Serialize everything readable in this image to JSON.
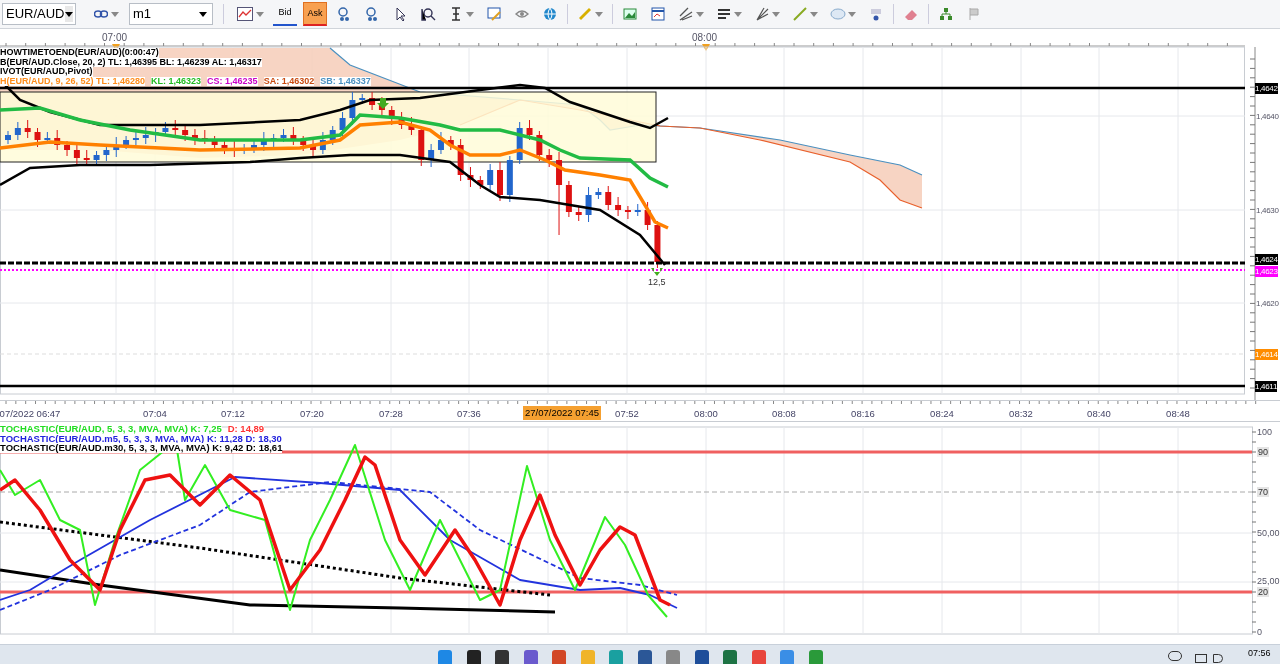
{
  "toolbar": {
    "symbol": "EUR/AUD",
    "timeframe": "m1",
    "price_buttons": [
      {
        "label": "Bid",
        "selected": false
      },
      {
        "label": "Ask",
        "selected": true
      }
    ]
  },
  "top_time_axis": {
    "labels": [
      "07:00",
      "08:00"
    ]
  },
  "main_chart": {
    "legend": [
      [
        {
          "text": "HOWTIMETOEND(EUR/AUD)(0:00:47)",
          "color": "#000000"
        }
      ],
      [
        {
          "text": "B(EUR/AUD.Close, 20, 2)  TL: 1,46395  BL: 1,46239  AL: 1,46317",
          "color": "#000000"
        }
      ],
      [
        {
          "text": "IVOT(EUR/AUD,Pivot)",
          "color": "#000000"
        }
      ],
      [
        {
          "text": "H(EUR/AUD, 9, 26, 52)  TL: 1,46280",
          "color": "#ff8c1a"
        },
        {
          "text": "KL: 1,46323",
          "color": "#22bb22"
        },
        {
          "text": "CS: 1,46235",
          "color": "#c800c8"
        },
        {
          "text": "SA: 1,46302",
          "color": "#c84a10"
        },
        {
          "text": "SB: 1,46337",
          "color": "#4a90c0"
        }
      ]
    ],
    "price_labels": [
      {
        "text": "1,4642",
        "kind": "badge",
        "color": "#000000"
      },
      {
        "text": "1,4640",
        "kind": "tick"
      },
      {
        "text": "1,4630",
        "kind": "tick"
      },
      {
        "text": "1,4624",
        "kind": "badge",
        "color": "#000000"
      },
      {
        "text": "1,4623",
        "kind": "badge",
        "color": "#ff00ff"
      },
      {
        "text": "1,4620",
        "kind": "tick"
      },
      {
        "text": "1,4614",
        "kind": "badge",
        "color": "#ff8c00"
      },
      {
        "text": "1,4611",
        "kind": "badge",
        "color": "#000000"
      }
    ],
    "marker_label": "12,5"
  },
  "time_axis": {
    "labels": [
      "07/2022 06:47",
      "07:04",
      "07:12",
      "07:20",
      "07:28",
      "07:36",
      "07:52",
      "08:00",
      "08:08",
      "08:16",
      "08:24",
      "08:32",
      "08:40",
      "08:48"
    ],
    "cursor_label": "27/07/2022 07:45"
  },
  "stochastic": {
    "legend": [
      [
        {
          "text": "TOCHASTIC(EUR/AUD, 5, 3, 3, MVA, MVA)  K: 7,25",
          "color": "#22dd22"
        },
        {
          "text": "D: 14,89",
          "color": "#ff3333"
        }
      ],
      [
        {
          "text": "TOCHASTIC(EUR/AUD.m5, 5, 3, 3, MVA, MVA)  K: 11,28  D: 18,30",
          "color": "#2222dd"
        }
      ],
      [
        {
          "text": "TOCHASTIC(EUR/AUD.m30, 5, 3, 3, MVA, MVA)  K: 9,42  D: 18,61",
          "color": "#000000"
        }
      ]
    ],
    "scale_labels": [
      {
        "text": "100",
        "kind": "tick"
      },
      {
        "text": "90",
        "kind": "badge"
      },
      {
        "text": "70",
        "kind": "badge"
      },
      {
        "text": "50,00",
        "kind": "tick"
      },
      {
        "text": "25,00",
        "kind": "tick"
      },
      {
        "text": "20",
        "kind": "badge"
      },
      {
        "text": "0",
        "kind": "tick"
      }
    ]
  },
  "taskbar": {
    "time": "07:56"
  }
}
